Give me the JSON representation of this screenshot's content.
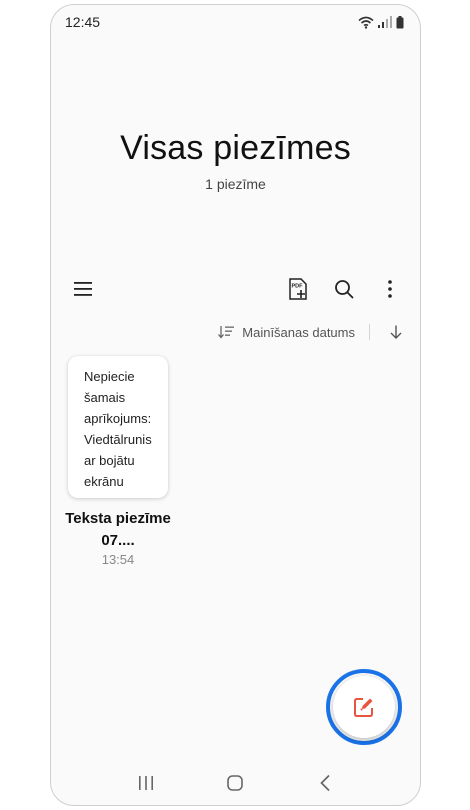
{
  "status_bar": {
    "time": "12:45"
  },
  "header": {
    "title": "Visas piezīmes",
    "subtitle": "1 piezīme"
  },
  "toolbar": {
    "icons": [
      "menu-icon",
      "pdf-add-icon",
      "search-icon",
      "more-vert-icon"
    ]
  },
  "sort": {
    "label": "Mainīšanas datums"
  },
  "notes": [
    {
      "preview": "Nepiecie\nšamais\naprīkojums:\nViedtālrunis\nar bojātu\nekrānu",
      "title": "Teksta piezīme 07....",
      "time": "13:54"
    }
  ],
  "fab": {
    "icon": "compose-icon",
    "accent_color": "#e8553e",
    "ring_color": "#1a73e8"
  },
  "nav": {
    "icons": [
      "recents-icon",
      "home-icon",
      "back-icon"
    ]
  }
}
